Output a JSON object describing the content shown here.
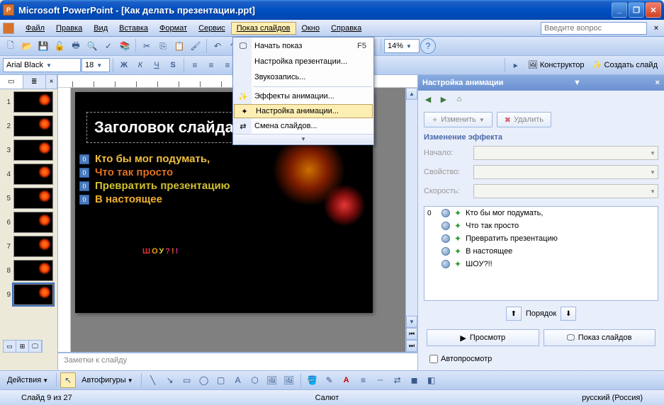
{
  "title": "Microsoft PowerPoint - [Как делать презентации.ppt]",
  "menubar": {
    "items": [
      "Файл",
      "Правка",
      "Вид",
      "Вставка",
      "Формат",
      "Сервис",
      "Показ слайдов",
      "Окно",
      "Справка"
    ],
    "ask_placeholder": "Введите вопрос"
  },
  "toolbar2": {
    "font": "Arial Black",
    "size": "18",
    "zoom": "14%",
    "designer": "Конструктор",
    "new_slide": "Создать слайд"
  },
  "dropdown": {
    "items": [
      {
        "label": "Начать показ",
        "shortcut": "F5"
      },
      {
        "label": "Настройка презентации..."
      },
      {
        "label": "Звукозапись..."
      },
      {
        "label": "Эффекты анимации..."
      },
      {
        "label": "Настройка анимации...",
        "selected": true
      },
      {
        "label": "Смена слайдов..."
      }
    ]
  },
  "slide": {
    "title": "Заголовок слайда",
    "bullets": [
      {
        "n": "0",
        "text": "Кто бы мог подумать,",
        "color": "#f0c040"
      },
      {
        "n": "0",
        "text": "Что так просто",
        "color": "#e07020"
      },
      {
        "n": "0",
        "text": "Превратить презентацию",
        "color": "#d0c030"
      },
      {
        "n": "0",
        "text": "В настоящее",
        "color": "#f0b030"
      }
    ],
    "show": "ШОУ?!!"
  },
  "notes": "Заметки к слайду",
  "thumbs": [
    "1",
    "2",
    "3",
    "4",
    "5",
    "6",
    "7",
    "8",
    "9"
  ],
  "taskpane": {
    "title": "Настройка анимации",
    "change": "Изменить",
    "delete": "Удалить",
    "section": "Изменение эффекта",
    "props": [
      "Начало:",
      "Свойство:",
      "Скорость:"
    ],
    "anims": [
      {
        "ord": "0",
        "text": "Кто бы мог подумать,"
      },
      {
        "ord": "",
        "text": "Что так просто"
      },
      {
        "ord": "",
        "text": "Превратить презентацию"
      },
      {
        "ord": "",
        "text": "В настоящее"
      },
      {
        "ord": "",
        "text": "ШОУ?!!"
      }
    ],
    "order": "Порядок",
    "preview": "Просмотр",
    "slideshow": "Показ слайдов",
    "autopreview": "Автопросмотр"
  },
  "drawbar": {
    "actions": "Действия",
    "autoshapes": "Автофигуры"
  },
  "status": {
    "left": "Слайд 9 из 27",
    "mid": "Салют",
    "right": "русский (Россия)"
  }
}
